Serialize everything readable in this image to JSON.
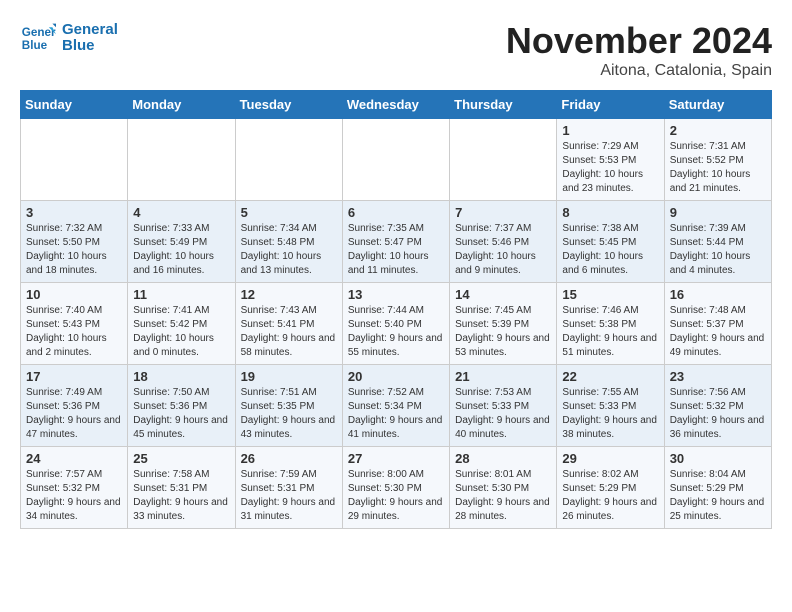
{
  "logo": {
    "line1": "General",
    "line2": "Blue"
  },
  "title": "November 2024",
  "location": "Aitona, Catalonia, Spain",
  "days_of_week": [
    "Sunday",
    "Monday",
    "Tuesday",
    "Wednesday",
    "Thursday",
    "Friday",
    "Saturday"
  ],
  "weeks": [
    [
      {
        "day": "",
        "info": ""
      },
      {
        "day": "",
        "info": ""
      },
      {
        "day": "",
        "info": ""
      },
      {
        "day": "",
        "info": ""
      },
      {
        "day": "",
        "info": ""
      },
      {
        "day": "1",
        "info": "Sunrise: 7:29 AM\nSunset: 5:53 PM\nDaylight: 10 hours and 23 minutes."
      },
      {
        "day": "2",
        "info": "Sunrise: 7:31 AM\nSunset: 5:52 PM\nDaylight: 10 hours and 21 minutes."
      }
    ],
    [
      {
        "day": "3",
        "info": "Sunrise: 7:32 AM\nSunset: 5:50 PM\nDaylight: 10 hours and 18 minutes."
      },
      {
        "day": "4",
        "info": "Sunrise: 7:33 AM\nSunset: 5:49 PM\nDaylight: 10 hours and 16 minutes."
      },
      {
        "day": "5",
        "info": "Sunrise: 7:34 AM\nSunset: 5:48 PM\nDaylight: 10 hours and 13 minutes."
      },
      {
        "day": "6",
        "info": "Sunrise: 7:35 AM\nSunset: 5:47 PM\nDaylight: 10 hours and 11 minutes."
      },
      {
        "day": "7",
        "info": "Sunrise: 7:37 AM\nSunset: 5:46 PM\nDaylight: 10 hours and 9 minutes."
      },
      {
        "day": "8",
        "info": "Sunrise: 7:38 AM\nSunset: 5:45 PM\nDaylight: 10 hours and 6 minutes."
      },
      {
        "day": "9",
        "info": "Sunrise: 7:39 AM\nSunset: 5:44 PM\nDaylight: 10 hours and 4 minutes."
      }
    ],
    [
      {
        "day": "10",
        "info": "Sunrise: 7:40 AM\nSunset: 5:43 PM\nDaylight: 10 hours and 2 minutes."
      },
      {
        "day": "11",
        "info": "Sunrise: 7:41 AM\nSunset: 5:42 PM\nDaylight: 10 hours and 0 minutes."
      },
      {
        "day": "12",
        "info": "Sunrise: 7:43 AM\nSunset: 5:41 PM\nDaylight: 9 hours and 58 minutes."
      },
      {
        "day": "13",
        "info": "Sunrise: 7:44 AM\nSunset: 5:40 PM\nDaylight: 9 hours and 55 minutes."
      },
      {
        "day": "14",
        "info": "Sunrise: 7:45 AM\nSunset: 5:39 PM\nDaylight: 9 hours and 53 minutes."
      },
      {
        "day": "15",
        "info": "Sunrise: 7:46 AM\nSunset: 5:38 PM\nDaylight: 9 hours and 51 minutes."
      },
      {
        "day": "16",
        "info": "Sunrise: 7:48 AM\nSunset: 5:37 PM\nDaylight: 9 hours and 49 minutes."
      }
    ],
    [
      {
        "day": "17",
        "info": "Sunrise: 7:49 AM\nSunset: 5:36 PM\nDaylight: 9 hours and 47 minutes."
      },
      {
        "day": "18",
        "info": "Sunrise: 7:50 AM\nSunset: 5:36 PM\nDaylight: 9 hours and 45 minutes."
      },
      {
        "day": "19",
        "info": "Sunrise: 7:51 AM\nSunset: 5:35 PM\nDaylight: 9 hours and 43 minutes."
      },
      {
        "day": "20",
        "info": "Sunrise: 7:52 AM\nSunset: 5:34 PM\nDaylight: 9 hours and 41 minutes."
      },
      {
        "day": "21",
        "info": "Sunrise: 7:53 AM\nSunset: 5:33 PM\nDaylight: 9 hours and 40 minutes."
      },
      {
        "day": "22",
        "info": "Sunrise: 7:55 AM\nSunset: 5:33 PM\nDaylight: 9 hours and 38 minutes."
      },
      {
        "day": "23",
        "info": "Sunrise: 7:56 AM\nSunset: 5:32 PM\nDaylight: 9 hours and 36 minutes."
      }
    ],
    [
      {
        "day": "24",
        "info": "Sunrise: 7:57 AM\nSunset: 5:32 PM\nDaylight: 9 hours and 34 minutes."
      },
      {
        "day": "25",
        "info": "Sunrise: 7:58 AM\nSunset: 5:31 PM\nDaylight: 9 hours and 33 minutes."
      },
      {
        "day": "26",
        "info": "Sunrise: 7:59 AM\nSunset: 5:31 PM\nDaylight: 9 hours and 31 minutes."
      },
      {
        "day": "27",
        "info": "Sunrise: 8:00 AM\nSunset: 5:30 PM\nDaylight: 9 hours and 29 minutes."
      },
      {
        "day": "28",
        "info": "Sunrise: 8:01 AM\nSunset: 5:30 PM\nDaylight: 9 hours and 28 minutes."
      },
      {
        "day": "29",
        "info": "Sunrise: 8:02 AM\nSunset: 5:29 PM\nDaylight: 9 hours and 26 minutes."
      },
      {
        "day": "30",
        "info": "Sunrise: 8:04 AM\nSunset: 5:29 PM\nDaylight: 9 hours and 25 minutes."
      }
    ]
  ]
}
